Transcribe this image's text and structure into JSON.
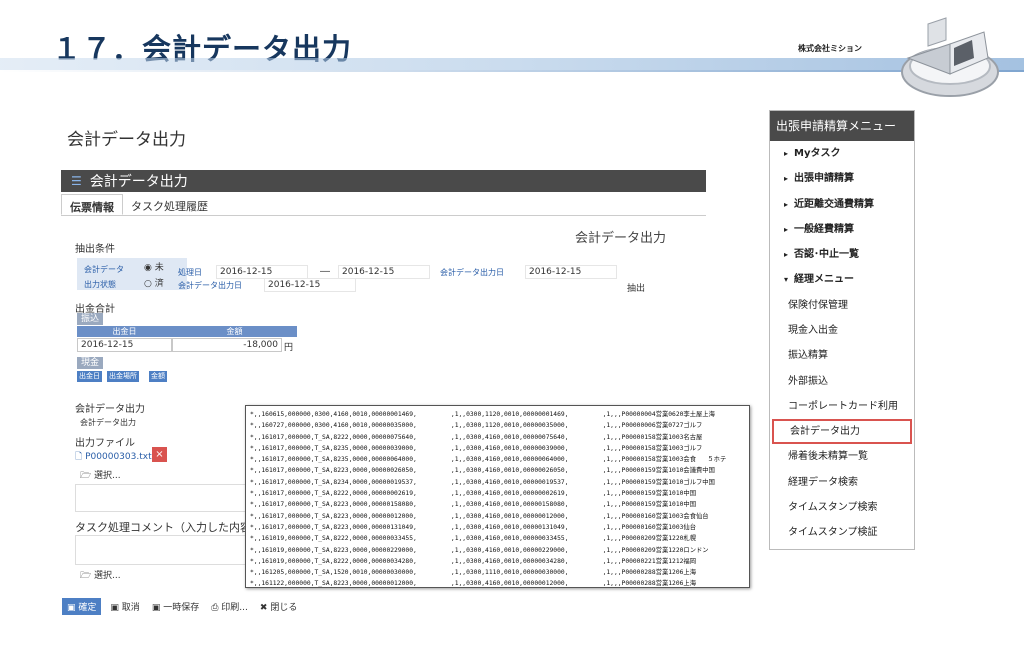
{
  "slide": {
    "title": "１７．会計データ出力",
    "company": "株式会社ミション"
  },
  "page": {
    "title": "会計データ出力",
    "panel_title": "会計データ出力",
    "tabs": [
      "伝票情報",
      "タスク処理履歴"
    ],
    "form_heading": "会計データ出力"
  },
  "extract": {
    "label": "抽出条件",
    "acct_data_label": "会計データ",
    "output_status_label": "出力状態",
    "radio_not": "未",
    "radio_done": "済",
    "process_date_label": "処理日",
    "process_date_from": "2016-12-15",
    "range_sep": "―",
    "process_date_to": "2016-12-15",
    "acct_output_date_label": "会計データ出力日",
    "acct_output_date_value": "2016-12-15",
    "acct_output_date2_label": "会計データ出力日",
    "acct_output_date2_value": "2016-12-15",
    "extract_button": "抽出"
  },
  "payout": {
    "label": "出金合計",
    "transfer_badge": "振込",
    "col_date": "出金日",
    "col_amount": "金額",
    "date_value": "2016-12-15",
    "amount_value": "-18,000",
    "yen": "円",
    "cash_badge": "現金",
    "cash_cols": [
      "出金日",
      "出金場所",
      "金額"
    ]
  },
  "acct_output": {
    "label": "会計データ出力",
    "sub_label": "会計データ出力",
    "file_label": "出力ファイル",
    "file_name": "P00000303.txt",
    "delete_icon": "×",
    "select_label": "選択...",
    "comment_label": "タスク処理コメント（入力した内容は",
    "select_label2": "選択..."
  },
  "csv_lines": [
    "*,,160615,000000,0300,4160,0010,00000001469,         ,1,,0300,1120,0010,00000001469,         ,1,,,P00000004営業0620李土屋上海",
    "*,,160727,000000,0300,4160,0010,00000035000,         ,1,,0300,1120,0010,00000035000,         ,1,,,P00000006営業0727ゴルフ",
    "*,,161017,000000,T_SA,8222,0000,00000075640,         ,1,,0300,4160,0010,00000075640,         ,1,,,P00000158営業1003名古屋",
    "*,,161017,000000,T_SA,8235,0000,00000039000,         ,1,,0300,4160,0010,00000039000,         ,1,,,P00000158営業1003ゴルフ",
    "*,,161017,000000,T_SA,8235,0000,00000064000,         ,1,,0300,4160,0010,00000064000,         ,1,,,P00000158営業1003会食   ５ホテ",
    "*,,161017,000000,T_SA,8223,0000,00000026050,         ,1,,0300,4160,0010,00000026050,         ,1,,,P00000159営業1010会議費中国",
    "*,,161017,000000,T_SA,8234,0000,00000019537,         ,1,,0300,4160,0010,00000019537,         ,1,,,P00000159営業1010ゴルフ中国",
    "*,,161017,000000,T_SA,8222,0000,00000002619,         ,1,,0300,4160,0010,00000002619,         ,1,,,P00000159営業1010中国",
    "*,,161017,000000,T_SA,8223,0000,00000158080,         ,1,,0300,4160,0010,00000158080,         ,1,,,P00000159営業1010中国",
    "*,,161017,000000,T_SA,8223,0000,00000012000,         ,1,,0300,4160,0010,00000012000,         ,1,,,P00000160営業1003会食仙台",
    "*,,161017,000000,T_SA,8223,0000,00000131049,         ,1,,0300,4160,0010,00000131049,         ,1,,,P00000160営業1003仙台",
    "*,,161019,000000,T_SA,8222,0000,00000033455,         ,1,,0300,4160,0010,00000033455,         ,1,,,P00000209営業1220札幌",
    "*,,161019,000000,T_SA,8223,0000,00000229000,         ,1,,0300,4160,0010,00000229000,         ,1,,,P00000209営業1220ロンドン",
    "*,,161019,000000,T_SA,8222,0000,00000034280,         ,1,,0300,4160,0010,00000034280,         ,1,,,P00000221営業1212福岡",
    "*,,161205,000000,T_SA,1520,0010,00000030000,         ,1,,0300,1110,0010,00000030000,         ,1,,,P00000288営業1206上海",
    "*,,161122,000000,T_SA,8223,0000,00000012000,         ,1,,0300,4160,0010,00000012000,         ,1,,,P00000288営業1206上海"
  ],
  "bottom_bar": {
    "confirm": "確定",
    "cancel": "取消",
    "temp_save": "一時保存",
    "print": "印刷...",
    "close": "閉じる"
  },
  "sidebar": {
    "title": "出張申請精算メニュー",
    "items": [
      {
        "label": "Myタスク",
        "bold": true,
        "chevron": "▸"
      },
      {
        "label": "出張申請精算",
        "bold": true,
        "chevron": "▸"
      },
      {
        "label": "近距離交通費精算",
        "bold": true,
        "chevron": "▸"
      },
      {
        "label": "一般経費精算",
        "bold": true,
        "chevron": "▸"
      },
      {
        "label": "否認･中止一覧",
        "bold": true,
        "chevron": "▸"
      },
      {
        "label": "経理メニュー",
        "bold": true,
        "chevron": "▾"
      },
      {
        "label": "保険付保管理",
        "bold": false,
        "chevron": ""
      },
      {
        "label": "現金入出金",
        "bold": false,
        "chevron": ""
      },
      {
        "label": "振込精算",
        "bold": false,
        "chevron": ""
      },
      {
        "label": "外部振込",
        "bold": false,
        "chevron": ""
      },
      {
        "label": "コーポレートカード利用",
        "bold": false,
        "chevron": ""
      },
      {
        "label": "会計データ出力",
        "bold": false,
        "chevron": "",
        "highlight": true
      },
      {
        "label": "帰着後未精算一覧",
        "bold": false,
        "chevron": ""
      },
      {
        "label": "経理データ検索",
        "bold": false,
        "chevron": ""
      },
      {
        "label": "タイムスタンプ検索",
        "bold": false,
        "chevron": ""
      },
      {
        "label": "タイムスタンプ検証",
        "bold": false,
        "chevron": ""
      }
    ]
  },
  "colors": {
    "title_navy": "#17375e",
    "panel_dark": "#4a4a4a",
    "accent_blue": "#4d7fc4",
    "highlight_red": "#d9534f"
  }
}
